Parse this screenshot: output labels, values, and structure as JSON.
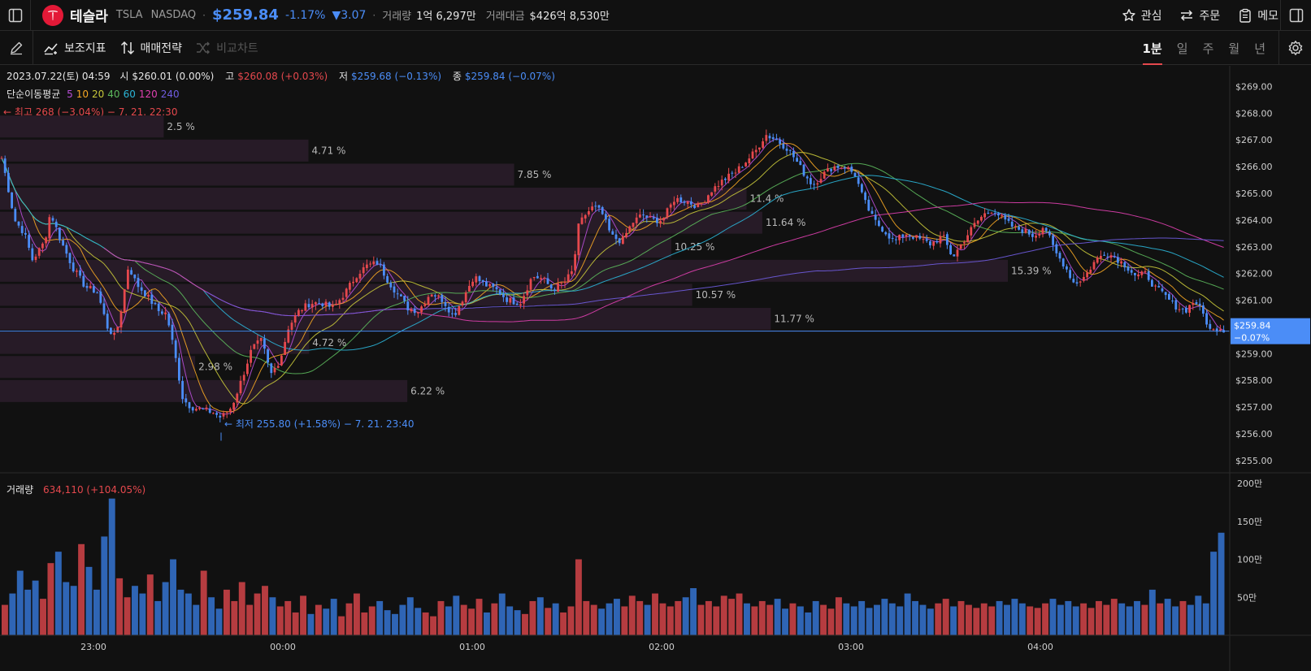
{
  "header": {
    "stock_name": "테슬라",
    "ticker": "TSLA",
    "exchange": "NASDAQ",
    "price": "$259.84",
    "change_pct": "-1.17%",
    "change_abs": "▼3.07",
    "volume_label": "거래량",
    "volume_value": "1억 6,297만",
    "turnover_label": "거래대금",
    "turnover_value": "$426억 8,530만",
    "actions": [
      "관심",
      "주문",
      "메모"
    ]
  },
  "toolbar": {
    "indicators_label": "보조지표",
    "strategy_label": "매매전략",
    "compare_label": "비교차트",
    "periods": [
      "1분",
      "일",
      "주",
      "월",
      "년"
    ],
    "active_period": "1분"
  },
  "ohlc": {
    "date": "2023.07.22(토) 04:59",
    "open_label": "시",
    "open_value": "$260.01 (0.00%)",
    "high_label": "고",
    "high_value": "$260.08 (+0.03%)",
    "low_label": "저",
    "low_value": "$259.68 (−0.13%)",
    "close_label": "종",
    "close_value": "$259.84 (−0.07%)"
  },
  "ma_legend": {
    "label": "단순이동평균",
    "periods": [
      {
        "text": "5",
        "color": "#b84fd8"
      },
      {
        "text": "10",
        "color": "#f5a623"
      },
      {
        "text": "20",
        "color": "#c8c83a"
      },
      {
        "text": "40",
        "color": "#5cb85c"
      },
      {
        "text": "60",
        "color": "#2bb5d8"
      },
      {
        "text": "120",
        "color": "#e040b0"
      },
      {
        "text": "240",
        "color": "#6f5ce0"
      }
    ]
  },
  "annotations": {
    "high": "← 최고 268 (−3.04%) − 7. 21. 22:30",
    "low": "← 최저 255.80 (+1.58%) − 7. 21. 23:40"
  },
  "volume_panel": {
    "label": "거래량",
    "value": "634,110 (+104.05%)"
  },
  "colors": {
    "up": "#e5484d",
    "down": "#4b8df7",
    "background": "#111111",
    "profile": "#2b1d2b"
  },
  "chart_data": {
    "type": "candlestick",
    "price_axis": {
      "ticks": [
        "$269.00",
        "$268.00",
        "$267.00",
        "$266.00",
        "$265.00",
        "$264.00",
        "$263.00",
        "$262.00",
        "$261.00",
        "$260.00",
        "$259.00",
        "$258.00",
        "$257.00",
        "$256.00",
        "$255.00"
      ],
      "range": [
        254.6,
        269.5
      ],
      "last_price": "$259.84",
      "last_change": "−0.07%",
      "last_value": 259.84
    },
    "volume_axis": {
      "ticks": [
        "200만",
        "150만",
        "100만",
        "50만"
      ],
      "range": [
        0,
        200
      ]
    },
    "time_axis": {
      "ticks": [
        "23:00",
        "00:00",
        "01:00",
        "02:00",
        "03:00",
        "04:00"
      ]
    },
    "volume_profile": [
      {
        "price": 267.5,
        "pct": 2.5,
        "label": "2.5 %"
      },
      {
        "price": 266.6,
        "pct": 4.71,
        "label": "4.71 %"
      },
      {
        "price": 265.7,
        "pct": 7.85,
        "label": "7.85 %"
      },
      {
        "price": 264.8,
        "pct": 11.4,
        "label": "11.4 %"
      },
      {
        "price": 263.9,
        "pct": 11.64,
        "label": "11.64 %"
      },
      {
        "price": 263.0,
        "pct": 10.25,
        "label": "10.25 %"
      },
      {
        "price": 262.1,
        "pct": 15.39,
        "label": "15.39 %"
      },
      {
        "price": 261.2,
        "pct": 10.57,
        "label": "10.57 %"
      },
      {
        "price": 260.3,
        "pct": 11.77,
        "label": "11.77 %"
      },
      {
        "price": 259.4,
        "pct": 4.72,
        "label": "4.72 %"
      },
      {
        "price": 258.5,
        "pct": 2.98,
        "label": "2.98 %"
      },
      {
        "price": 257.6,
        "pct": 6.22,
        "label": "6.22 %"
      }
    ],
    "close_path": [
      [
        0,
        266.6
      ],
      [
        8,
        265.5
      ],
      [
        18,
        264.0
      ],
      [
        30,
        263.5
      ],
      [
        40,
        262.5
      ],
      [
        55,
        263.2
      ],
      [
        62,
        264.3
      ],
      [
        75,
        263.2
      ],
      [
        90,
        262.2
      ],
      [
        105,
        261.5
      ],
      [
        120,
        261.3
      ],
      [
        132,
        260.0
      ],
      [
        142,
        259.6
      ],
      [
        150,
        260.8
      ],
      [
        158,
        262.3
      ],
      [
        168,
        261.6
      ],
      [
        180,
        261.2
      ],
      [
        195,
        260.6
      ],
      [
        205,
        260.5
      ],
      [
        215,
        259.0
      ],
      [
        225,
        257.3
      ],
      [
        235,
        257.0
      ],
      [
        250,
        256.9
      ],
      [
        262,
        256.8
      ],
      [
        272,
        256.6
      ],
      [
        285,
        257.0
      ],
      [
        297,
        258.0
      ],
      [
        310,
        259.2
      ],
      [
        322,
        259.5
      ],
      [
        333,
        258.2
      ],
      [
        345,
        258.8
      ],
      [
        355,
        260.0
      ],
      [
        368,
        260.6
      ],
      [
        382,
        260.9
      ],
      [
        395,
        260.9
      ],
      [
        410,
        260.7
      ],
      [
        425,
        261.3
      ],
      [
        440,
        262.0
      ],
      [
        452,
        262.3
      ],
      [
        465,
        262.4
      ],
      [
        478,
        261.7
      ],
      [
        490,
        261.2
      ],
      [
        502,
        260.7
      ],
      [
        515,
        260.6
      ],
      [
        530,
        261.3
      ],
      [
        545,
        261.0
      ],
      [
        558,
        260.4
      ],
      [
        570,
        261.1
      ],
      [
        583,
        261.9
      ],
      [
        595,
        261.6
      ],
      [
        610,
        261.4
      ],
      [
        625,
        261.0
      ],
      [
        640,
        260.9
      ],
      [
        655,
        261.9
      ],
      [
        668,
        261.8
      ],
      [
        680,
        261.4
      ],
      [
        695,
        261.7
      ],
      [
        705,
        262.1
      ],
      [
        712,
        263.8
      ],
      [
        720,
        264.2
      ],
      [
        730,
        264.5
      ],
      [
        740,
        264.3
      ],
      [
        752,
        263.4
      ],
      [
        765,
        263.2
      ],
      [
        778,
        263.9
      ],
      [
        790,
        264.2
      ],
      [
        802,
        264.0
      ],
      [
        815,
        264.0
      ],
      [
        830,
        264.8
      ],
      [
        845,
        264.7
      ],
      [
        860,
        264.5
      ],
      [
        875,
        265.1
      ],
      [
        890,
        265.5
      ],
      [
        905,
        265.8
      ],
      [
        918,
        266.2
      ],
      [
        930,
        266.6
      ],
      [
        942,
        267.2
      ],
      [
        955,
        267.0
      ],
      [
        968,
        266.7
      ],
      [
        978,
        266.3
      ],
      [
        988,
        265.8
      ],
      [
        1000,
        265.3
      ],
      [
        1012,
        265.7
      ],
      [
        1025,
        266.0
      ],
      [
        1040,
        266.0
      ],
      [
        1052,
        265.7
      ],
      [
        1062,
        264.8
      ],
      [
        1075,
        264.0
      ],
      [
        1088,
        263.6
      ],
      [
        1100,
        263.2
      ],
      [
        1115,
        263.5
      ],
      [
        1130,
        263.3
      ],
      [
        1145,
        263.1
      ],
      [
        1160,
        263.4
      ],
      [
        1172,
        262.6
      ],
      [
        1185,
        263.2
      ],
      [
        1198,
        263.8
      ],
      [
        1210,
        264.2
      ],
      [
        1222,
        264.4
      ],
      [
        1235,
        264.0
      ],
      [
        1248,
        263.7
      ],
      [
        1260,
        263.6
      ],
      [
        1272,
        263.4
      ],
      [
        1285,
        263.8
      ],
      [
        1298,
        262.8
      ],
      [
        1310,
        262.3
      ],
      [
        1322,
        261.6
      ],
      [
        1335,
        261.9
      ],
      [
        1348,
        262.5
      ],
      [
        1360,
        262.8
      ],
      [
        1372,
        262.6
      ],
      [
        1385,
        262.3
      ],
      [
        1398,
        261.9
      ],
      [
        1410,
        262.0
      ],
      [
        1420,
        261.5
      ],
      [
        1432,
        261.2
      ],
      [
        1445,
        260.8
      ],
      [
        1458,
        260.6
      ],
      [
        1470,
        261.0
      ],
      [
        1480,
        260.5
      ],
      [
        1490,
        259.8
      ],
      [
        1500,
        260.0
      ],
      [
        1508,
        259.84
      ]
    ],
    "volume_series": [
      40,
      55,
      85,
      60,
      72,
      48,
      95,
      110,
      70,
      65,
      120,
      90,
      60,
      130,
      180,
      75,
      50,
      65,
      55,
      80,
      45,
      70,
      100,
      60,
      55,
      40,
      85,
      50,
      35,
      60,
      45,
      70,
      40,
      55,
      65,
      50,
      38,
      45,
      30,
      52,
      28,
      40,
      35,
      48,
      25,
      42,
      55,
      30,
      38,
      45,
      33,
      28,
      40,
      50,
      36,
      30,
      25,
      45,
      38,
      52,
      40,
      35,
      48,
      30,
      42,
      55,
      38,
      33,
      28,
      45,
      50,
      36,
      42,
      30,
      38,
      100,
      45,
      40,
      35,
      42,
      48,
      38,
      52,
      45,
      40,
      55,
      42,
      38,
      45,
      50,
      62,
      40,
      45,
      38,
      52,
      48,
      55,
      42,
      38,
      45,
      40,
      48,
      35,
      42,
      38,
      30,
      45,
      40,
      35,
      50,
      42,
      38,
      45,
      36,
      40,
      48,
      42,
      38,
      55,
      45,
      40,
      35,
      42,
      48,
      38,
      45,
      40,
      36,
      42,
      38,
      45,
      40,
      48,
      42,
      38,
      36,
      42,
      48,
      40,
      45,
      38,
      42,
      36,
      45,
      40,
      48,
      42,
      38,
      45,
      40,
      60,
      42,
      48,
      38,
      45,
      40,
      52,
      42,
      110,
      135
    ]
  }
}
